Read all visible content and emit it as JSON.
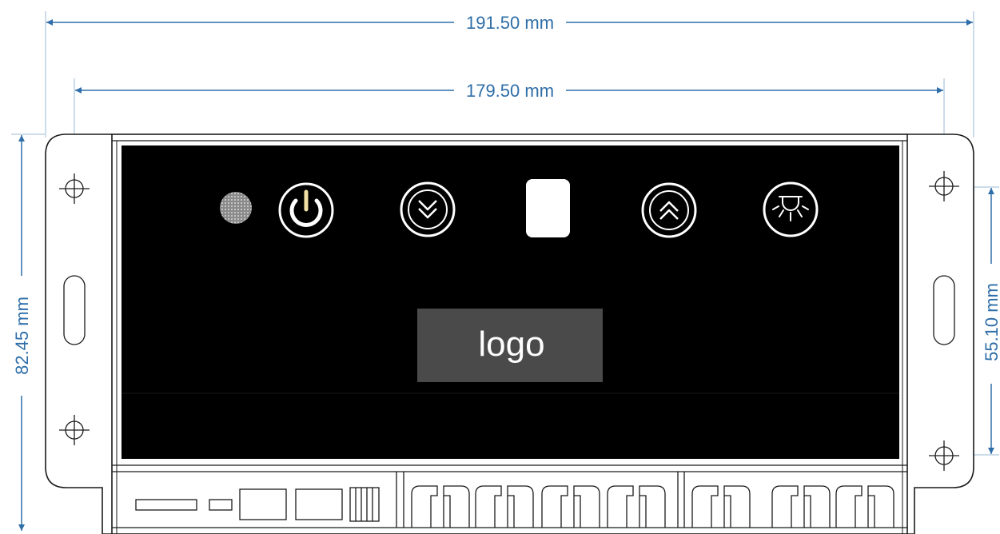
{
  "dimensions": {
    "overall_width": "191.50 mm",
    "inner_width": "179.50 mm",
    "overall_height": "82.45 mm",
    "mount_height": "55.10 mm"
  },
  "panel": {
    "logo_text": "logo",
    "buttons": [
      {
        "name": "power",
        "icon": "power-icon"
      },
      {
        "name": "down",
        "icon": "double-chevron-down-icon"
      },
      {
        "name": "display",
        "icon": "display-window"
      },
      {
        "name": "up",
        "icon": "double-chevron-up-icon"
      },
      {
        "name": "light",
        "icon": "light-icon"
      }
    ],
    "indicator": "speaker-grille"
  },
  "colors": {
    "dimension": "#2f6ea8",
    "panel": "#000000",
    "logo_box": "#4a4a4a",
    "outline": "#1a1a1a"
  }
}
